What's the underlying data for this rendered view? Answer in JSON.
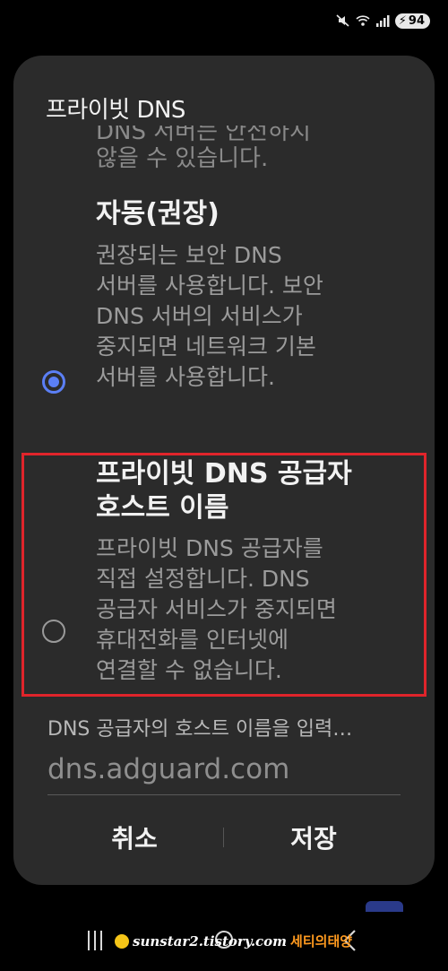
{
  "status_bar": {
    "battery_level": "94",
    "icons": [
      "mute-icon",
      "wifi-icon",
      "signal-icon",
      "battery-icon"
    ]
  },
  "dialog": {
    "title": "프라이빗 DNS",
    "scrolled_prev_lines": [
      "DNS 서버는 안전하지",
      "않을 수 있습니다."
    ],
    "options": [
      {
        "title_lines": [
          "자동(권장)"
        ],
        "description_lines": [
          "권장되는 보안 DNS",
          "서버를 사용합니다. 보안",
          "DNS 서버의 서비스가",
          "중지되면 네트워크 기본",
          "서버를 사용합니다."
        ],
        "selected": true
      },
      {
        "title_lines": [
          "프라이빗 DNS 공급자",
          "호스트 이름"
        ],
        "description_lines": [
          "프라이빗 DNS 공급자를",
          "직접 설정합니다. DNS",
          "공급자 서비스가 중지되면",
          "휴대전화를 인터넷에",
          "연결할 수 없습니다."
        ],
        "selected": false
      }
    ],
    "hostname_input": {
      "label": "DNS 공급자의 호스트 이름을 입력…",
      "value": "dns.adguard.com"
    },
    "buttons": {
      "cancel": "취소",
      "save": "저장"
    }
  },
  "watermark": {
    "url": "sunstar2.tistory.com",
    "name": "세티의태양"
  },
  "colors": {
    "accent": "#5b7ff5",
    "highlight": "#e0242b",
    "dialog_bg": "#2b2b2b"
  }
}
